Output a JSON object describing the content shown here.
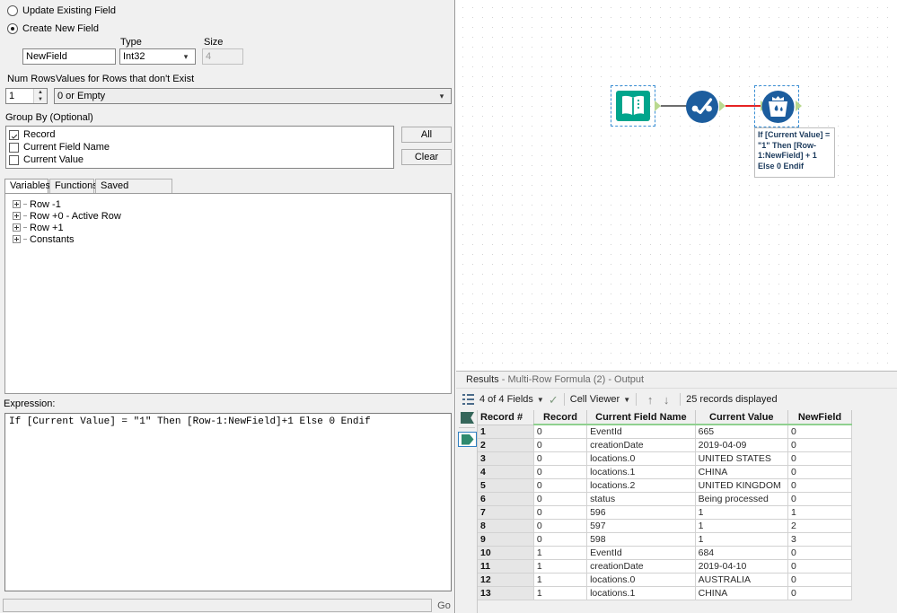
{
  "config": {
    "radio_update_label": "Update Existing Field",
    "radio_create_label": "Create New  Field",
    "radio_selected": "create",
    "type_label": "Type",
    "size_label": "Size",
    "field_name_value": "NewField",
    "type_value": "Int32",
    "size_value": "4",
    "num_rows_label": "Num Rows",
    "values_for_rows_label": "Values for Rows that don't Exist",
    "num_rows_value": "1",
    "values_for_rows_value": "0 or Empty",
    "group_by_label": "Group By (Optional)",
    "group_by_items": [
      {
        "label": "Record",
        "checked": true
      },
      {
        "label": "Current Field Name",
        "checked": false
      },
      {
        "label": "Current Value",
        "checked": false
      }
    ],
    "all_button": "All",
    "clear_button": "Clear"
  },
  "tabs": [
    {
      "label": "Variables",
      "active": true
    },
    {
      "label": "Functions",
      "active": false
    },
    {
      "label": "Saved Expressions",
      "active": false
    }
  ],
  "tree": [
    {
      "label": "Row -1"
    },
    {
      "label": "Row +0 - Active Row"
    },
    {
      "label": "Row +1"
    },
    {
      "label": "Constants"
    }
  ],
  "expression": {
    "label": "Expression:",
    "value": "If [Current Value] = \"1\" Then [Row-1:NewField]+1 Else 0 Endif"
  },
  "search": {
    "value": "",
    "go_label": "Go"
  },
  "canvas": {
    "nodes": [
      {
        "name": "input-data-node",
        "icon": "book-icon",
        "selected": true
      },
      {
        "name": "filter-node",
        "icon": "check-circle-icon",
        "selected": false
      },
      {
        "name": "multi-row-formula-node",
        "icon": "formula-bucket-icon",
        "selected": true
      }
    ],
    "annotation": "If [Current Value] = \"1\" Then [Row-1:NewField] + 1 Else 0 Endif",
    "colors": {
      "input_node": "#00a58c",
      "filter_node": "#1c5d9e",
      "formula_node": "#1c5d9e",
      "connector_red": "#e62222",
      "connector_grey": "#6d6d6d",
      "anchor_green": "#b9d98f",
      "selection_blue": "#3b8fd4"
    }
  },
  "results": {
    "title_main": "Results",
    "title_rest": "- Multi-Row Formula (2) - Output",
    "fields_label": "4 of 4 Fields",
    "viewer_label": "Cell Viewer",
    "records_label": "25 records displayed",
    "columns": [
      "Record #",
      "Record",
      "Current Field Name",
      "Current Value",
      "NewField"
    ],
    "rows": [
      [
        "1",
        "0",
        "EventId",
        "665",
        "0"
      ],
      [
        "2",
        "0",
        "creationDate",
        "2019-04-09",
        "0"
      ],
      [
        "3",
        "0",
        "locations.0",
        "UNITED STATES",
        "0"
      ],
      [
        "4",
        "0",
        "locations.1",
        "CHINA",
        "0"
      ],
      [
        "5",
        "0",
        "locations.2",
        "UNITED KINGDOM",
        "0"
      ],
      [
        "6",
        "0",
        "status",
        "Being processed",
        "0"
      ],
      [
        "7",
        "0",
        "596",
        "1",
        "1"
      ],
      [
        "8",
        "0",
        "597",
        "1",
        "2"
      ],
      [
        "9",
        "0",
        "598",
        "1",
        "3"
      ],
      [
        "10",
        "1",
        "EventId",
        "684",
        "0"
      ],
      [
        "11",
        "1",
        "creationDate",
        "2019-04-10",
        "0"
      ],
      [
        "12",
        "1",
        "locations.0",
        "AUSTRALIA",
        "0"
      ],
      [
        "13",
        "1",
        "locations.1",
        "CHINA",
        "0"
      ]
    ]
  }
}
